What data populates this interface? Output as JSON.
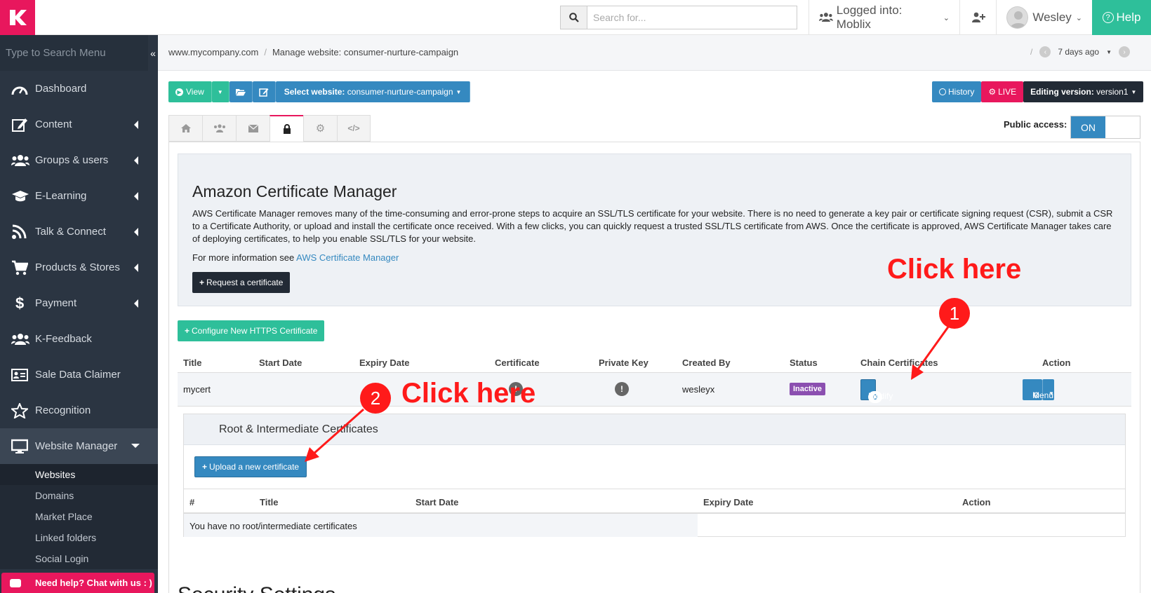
{
  "topbar": {
    "search_placeholder": "Search for...",
    "logged_into": "Logged into: Moblix",
    "user_name": "Wesley",
    "help_label": "Help"
  },
  "sidebar": {
    "search_placeholder": "Type to Search Menu",
    "items": [
      {
        "label": "Dashboard",
        "icon": "dashboard-icon"
      },
      {
        "label": "Content",
        "icon": "edit-icon"
      },
      {
        "label": "Groups & users",
        "icon": "users-icon"
      },
      {
        "label": "E-Learning",
        "icon": "graduation-cap-icon"
      },
      {
        "label": "Talk & Connect",
        "icon": "rss-icon"
      },
      {
        "label": "Products & Stores",
        "icon": "cart-icon"
      },
      {
        "label": "Payment",
        "icon": "dollar-icon"
      },
      {
        "label": "K-Feedback",
        "icon": "users-icon"
      },
      {
        "label": "Sale Data Claimer",
        "icon": "id-card-icon"
      },
      {
        "label": "Recognition",
        "icon": "star-icon"
      },
      {
        "label": "Website Manager",
        "icon": "desktop-icon"
      }
    ],
    "sub_items": [
      "Websites",
      "Domains",
      "Market Place",
      "Linked folders",
      "Social Login"
    ],
    "chat_label": "Need help? Chat with us : )"
  },
  "breadcrumb": {
    "site": "www.mycompany.com",
    "page": "Manage website: consumer-nurture-campaign",
    "version_time": "7 days ago"
  },
  "toolbar": {
    "view_label": "View",
    "select_website_prefix": "Select website:",
    "select_website_value": "consumer-nurture-campaign",
    "history_label": "History",
    "live_label": "LIVE",
    "editing_prefix": "Editing version:",
    "editing_value": "version1"
  },
  "access": {
    "label": "Public access:",
    "state": "ON"
  },
  "acm": {
    "title": "Amazon Certificate Manager",
    "description": "AWS Certificate Manager removes many of the time-consuming and error-prone steps to acquire an SSL/TLS certificate for your website. There is no need to generate a key pair or certificate signing request (CSR), submit a CSR to a Certificate Authority, or upload and install the certificate once received. With a few clicks, you can quickly request a trusted SSL/TLS certificate from AWS. Once the certificate is approved, AWS Certificate Manager takes care of deploying certificates, to help you enable SSL/TLS for your website.",
    "more_prefix": "For more information see",
    "more_link": "AWS Certificate Manager",
    "request_label": "Request a certificate"
  },
  "configure_label": "Configure New HTTPS Certificate",
  "cert_table": {
    "headers": [
      "Title",
      "Start Date",
      "Expiry Date",
      "Certificate",
      "Private Key",
      "Created By",
      "Status",
      "Chain Certificates",
      "Action"
    ],
    "row": {
      "title": "mycert",
      "created_by": "wesleyx",
      "status": "Inactive",
      "chain_count": "0",
      "modify_label": "Modify",
      "menu_label": "Menu"
    }
  },
  "intermediate": {
    "title": "Root & Intermediate Certificates",
    "upload_label": "Upload a new certificate",
    "headers": [
      "#",
      "Title",
      "Start Date",
      "Expiry Date",
      "Action"
    ],
    "empty_text": "You have no root/intermediate certificates"
  },
  "section_title": "Security Settings",
  "annotations": {
    "click_here_1": "Click here",
    "click_here_2": "Click here",
    "num_1": "1",
    "num_2": "2",
    "color": "#ff1a1a"
  }
}
